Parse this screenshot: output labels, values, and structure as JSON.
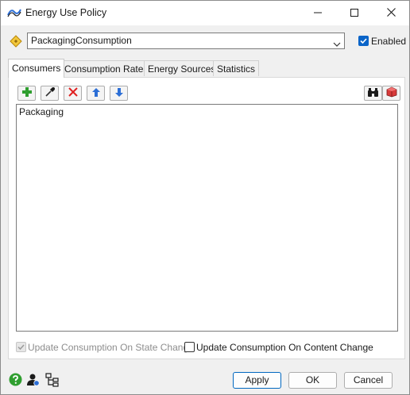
{
  "window": {
    "title": "Energy Use Policy",
    "icons": {
      "app": "energy-curve-icon",
      "minimize": "minimize-icon",
      "maximize": "maximize-icon",
      "close": "close-icon"
    }
  },
  "policy": {
    "selected": "PackagingConsumption",
    "icon": "diamond-tag-icon",
    "enabled_label": "Enabled",
    "enabled_checked": true
  },
  "tabs": [
    "Consumers",
    "Consumption Rates",
    "Energy Sources",
    "Statistics"
  ],
  "active_tab": "Consumers",
  "toolbar": {
    "add": "plus-icon",
    "sample": "eyedropper-icon",
    "remove": "red-x-icon",
    "move_up": "arrow-up-icon",
    "move_down": "arrow-down-icon",
    "find": "binoculars-icon",
    "select": "red-cube-icon"
  },
  "consumers": [
    "Packaging"
  ],
  "options": {
    "state_change_label": "Update Consumption On State Change",
    "state_change_checked": true,
    "state_change_disabled": true,
    "content_change_label": "Update Consumption On Content Change",
    "content_change_checked": false
  },
  "footer": {
    "icons": [
      "help-icon",
      "user-settings-icon",
      "tree-icon"
    ],
    "apply_label": "Apply",
    "ok_label": "OK",
    "cancel_label": "Cancel"
  },
  "colors": {
    "accent": "#0a64c8",
    "add_green": "#2f9e2f",
    "remove_red": "#e02020",
    "arrow_blue": "#2d6fd6"
  }
}
